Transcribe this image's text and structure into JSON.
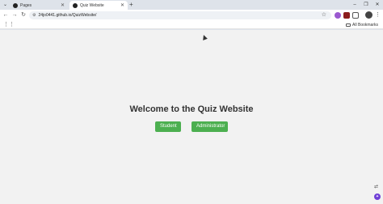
{
  "browser": {
    "tabs": [
      {
        "title": "Pages",
        "active": false
      },
      {
        "title": "Quiz Website",
        "active": true
      }
    ],
    "address": "24jo0441.github.io/QuizWebsite/",
    "bookmarks_label": "All Bookmarks",
    "colors": {
      "ext1": "#9b59d0",
      "ext2": "#8b1d1d"
    }
  },
  "page": {
    "heading": "Welcome to the Quiz Website",
    "buttons": {
      "student": "Student",
      "administrator": "Administrator"
    },
    "colors": {
      "button": "#4caf50",
      "background": "#f2f2f2"
    }
  }
}
